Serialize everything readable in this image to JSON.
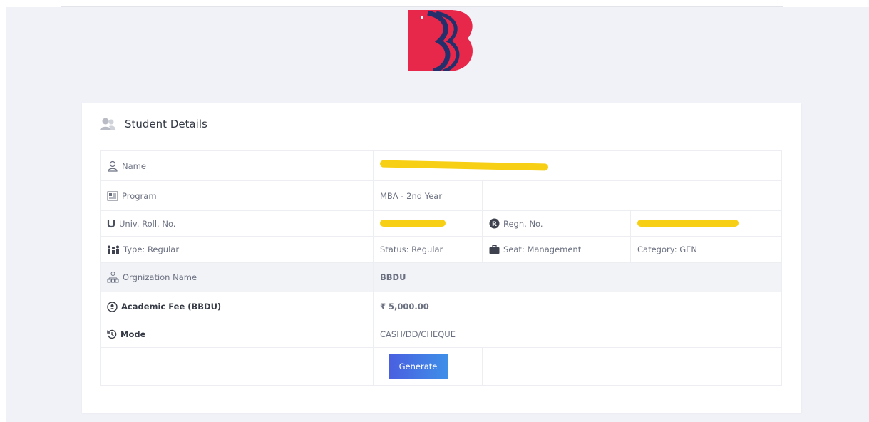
{
  "card": {
    "title": "Student Details"
  },
  "rows": {
    "name": {
      "label": "Name"
    },
    "program": {
      "label": "Program",
      "value": "MBA - 2nd Year"
    },
    "roll": {
      "label": "Univ. Roll. No.",
      "regn_label": "Regn. No."
    },
    "type": {
      "type": "Type: Regular",
      "status": "Status: Regular",
      "seat": "Seat: Management",
      "category": "Category: GEN"
    },
    "org": {
      "label": "Orgnization Name",
      "value": "BBDU"
    },
    "fee": {
      "label": "Academic Fee (BBDU)",
      "value": "₹ 5,000.00"
    },
    "mode": {
      "label": "Mode",
      "value": "CASH/DD/CHEQUE"
    }
  },
  "actions": {
    "generate_label": "Generate"
  },
  "colors": {
    "logo_red": "#e8284b",
    "logo_navy": "#24306b",
    "redaction": "#f7cf14",
    "button_gradient_start": "#4a5fe0",
    "button_gradient_end": "#3e8fe8"
  },
  "icons": {
    "header": "users-icon",
    "name": "user-outline-icon",
    "program": "newspaper-icon",
    "roll": "u-letter-icon",
    "regn": "r-circle-icon",
    "type": "family-icon",
    "seat": "briefcase-icon",
    "org": "org-chart-icon",
    "fee": "money-circle-icon",
    "mode": "history-icon"
  }
}
